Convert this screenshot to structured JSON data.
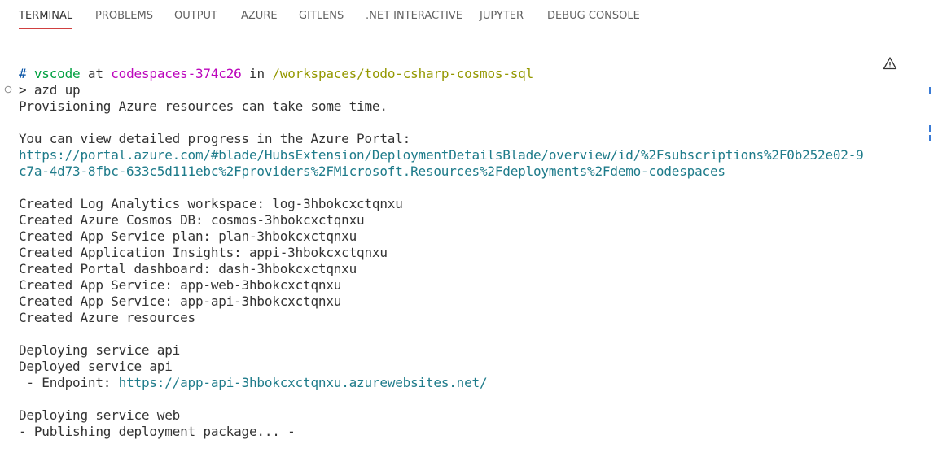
{
  "tabs": [
    {
      "label": "TERMINAL",
      "active": true
    },
    {
      "label": "PROBLEMS",
      "active": false
    },
    {
      "label": "OUTPUT",
      "active": false
    },
    {
      "label": "AZURE",
      "active": false
    },
    {
      "label": "GITLENS",
      "active": false
    },
    {
      "label": ".NET INTERACTIVE",
      "active": false
    },
    {
      "label": "JUPYTER",
      "active": false
    },
    {
      "label": "DEBUG CONSOLE",
      "active": false
    }
  ],
  "prompt": {
    "hash": "#",
    "user": "vscode",
    "at": "at",
    "host": "codespaces-374c26",
    "in": "in",
    "path": "/workspaces/todo-csharp-cosmos-sql"
  },
  "command": "> azd up",
  "output": {
    "provisioning": "Provisioning Azure resources can take some time.",
    "view_progress": "You can view detailed progress in the Azure Portal:",
    "portal_url_line1": "https://portal.azure.com/#blade/HubsExtension/DeploymentDetailsBlade/overview/id/%2Fsubscriptions%2F0b252e02-9",
    "portal_url_line2": "c7a-4d73-8fbc-633c5d111ebc%2Fproviders%2FMicrosoft.Resources%2Fdeployments%2Fdemo-codespaces",
    "created": [
      "Created Log Analytics workspace: log-3hbokcxctqnxu",
      "Created Azure Cosmos DB: cosmos-3hbokcxctqnxu",
      "Created App Service plan: plan-3hbokcxctqnxu",
      "Created Application Insights: appi-3hbokcxctqnxu",
      "Created Portal dashboard: dash-3hbokcxctqnxu",
      "Created App Service: app-web-3hbokcxctqnxu",
      "Created App Service: app-api-3hbokcxctqnxu",
      "Created Azure resources"
    ],
    "deploying_api": "Deploying service api",
    "deployed_api": "Deployed service api",
    "endpoint_label": " - Endpoint: ",
    "endpoint_url": "https://app-api-3hbokcxctqnxu.azurewebsites.net/",
    "deploying_web": "Deploying service web",
    "publishing": "- Publishing deployment package... -"
  },
  "icons": {
    "warning": "warning-icon",
    "command_decoration": "circle-decoration-icon"
  },
  "colors": {
    "active_tab_underline": "#d04040",
    "prompt_hash": "#0451a5",
    "prompt_user": "#00a040",
    "prompt_host": "#bc05bc",
    "prompt_path": "#949800",
    "link": "#1e7b8a",
    "scroll_marker": "#3a7bd5"
  }
}
